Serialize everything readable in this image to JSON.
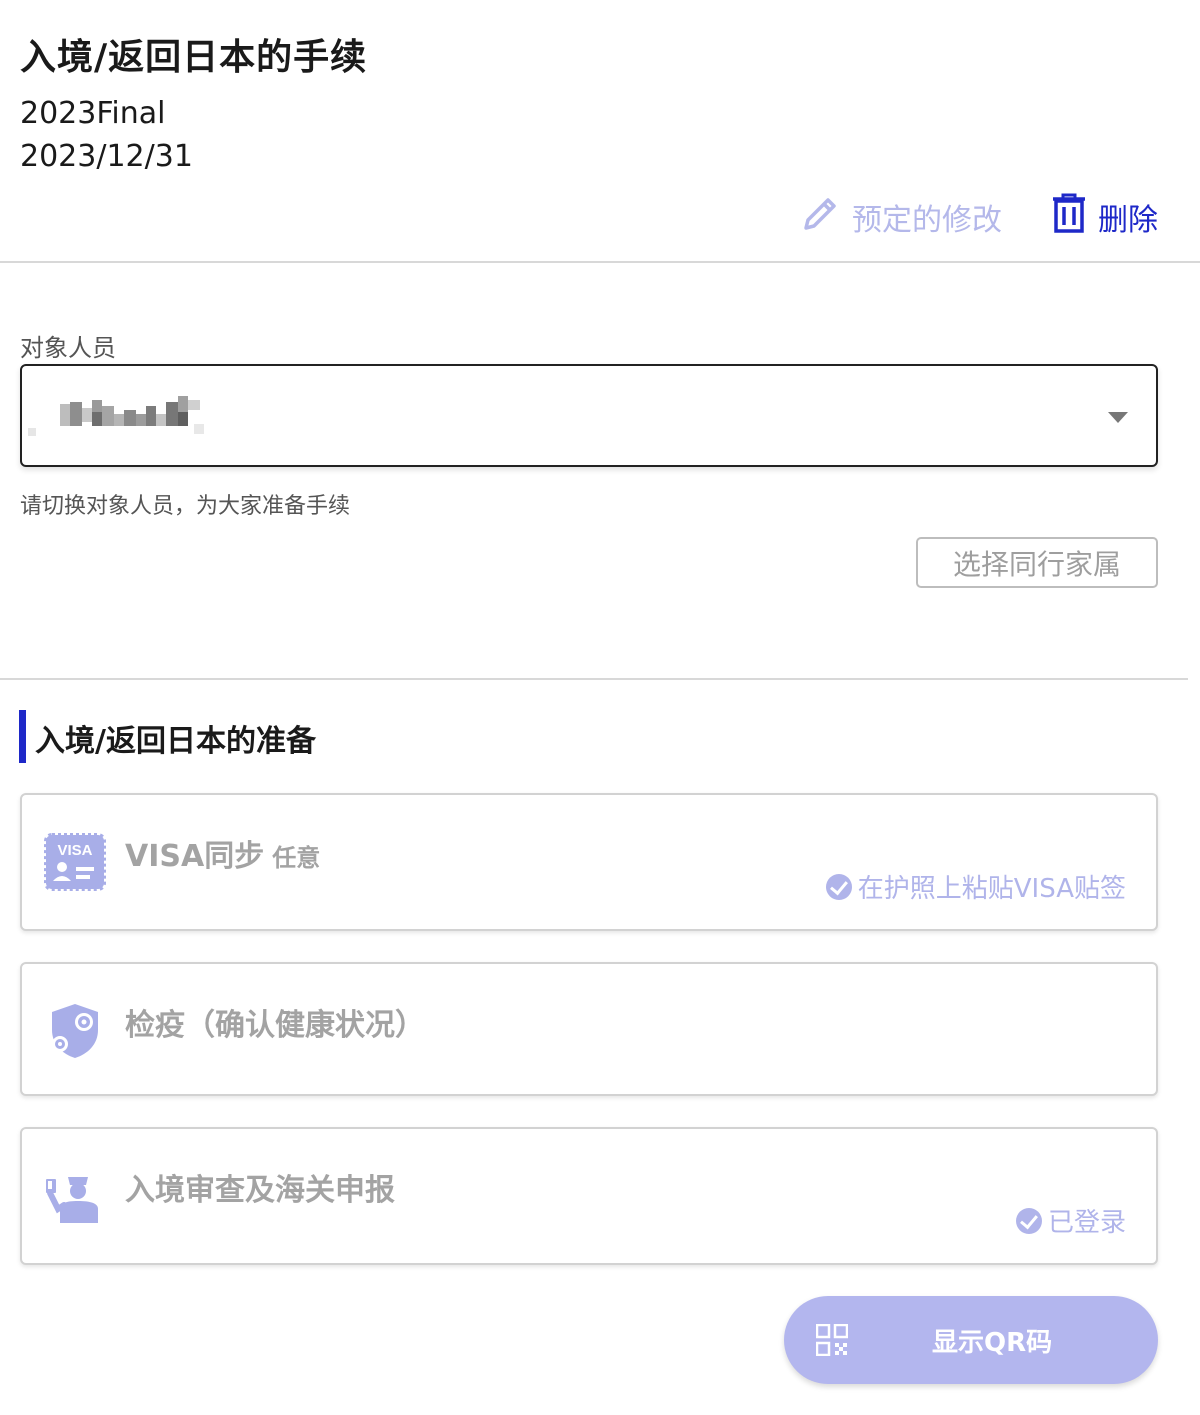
{
  "header": {
    "title": "入境/返回日本的手续",
    "plan_name": "2023Final",
    "date": "2023/12/31",
    "edit_label": "预定的修改",
    "delete_label": "删除"
  },
  "person": {
    "label": "对象人员",
    "hint": "请切换对象人员，为大家准备手续",
    "family_button": "选择同行家属"
  },
  "section": {
    "title": "入境/返回日本的准备",
    "cards": [
      {
        "title": "VISA同步",
        "tag": "任意",
        "status": "在护照上粘贴VISA贴签",
        "icon": "visa-icon"
      },
      {
        "title": "检疫（确认健康状况）",
        "icon": "quarantine-shield-icon"
      },
      {
        "title": "入境审查及海关申报",
        "status": "已登录",
        "icon": "immigration-officer-icon"
      }
    ]
  },
  "qr": {
    "label": "显示QR码"
  },
  "colors": {
    "accent": "#1e28c8",
    "muted_accent": "#b3b6ee",
    "icon_tint": "#a8aee8"
  }
}
